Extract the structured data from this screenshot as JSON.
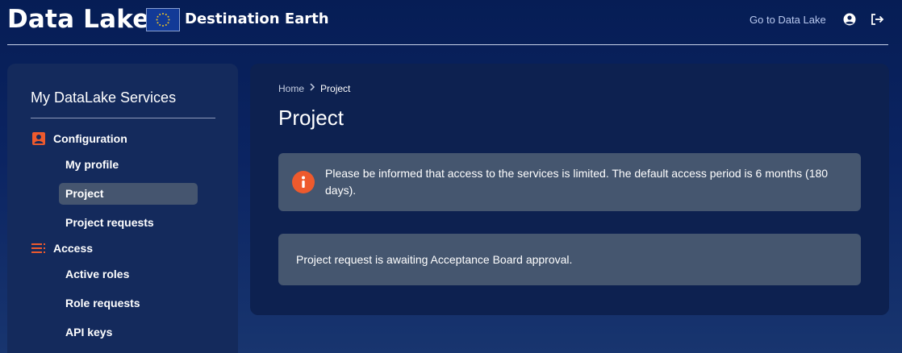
{
  "header": {
    "brand": "Data Lake",
    "partner": "Destination Earth",
    "goto_link": "Go to Data Lake",
    "user_icon": "user-circle-icon",
    "logout_icon": "logout-icon"
  },
  "sidebar": {
    "title": "My DataLake Services",
    "sections": [
      {
        "label": "Configuration",
        "icon": "user-badge-icon",
        "items": [
          {
            "label": "My profile"
          },
          {
            "label": "Project",
            "active": true
          },
          {
            "label": "Project requests"
          }
        ]
      },
      {
        "label": "Access",
        "icon": "list-icon",
        "items": [
          {
            "label": "Active roles"
          },
          {
            "label": "Role requests"
          },
          {
            "label": "API keys"
          }
        ]
      }
    ]
  },
  "main": {
    "breadcrumb": {
      "home": "Home",
      "current": "Project"
    },
    "title": "Project",
    "info_alert": "Please be informed that access to the services is limited. The default access period is 6 months (180 days).",
    "status_alert": "Project request is awaiting Acceptance Board approval."
  },
  "colors": {
    "accent": "#ee5a2d",
    "active_item": "#45556f",
    "alert_bg": "#45566f"
  }
}
